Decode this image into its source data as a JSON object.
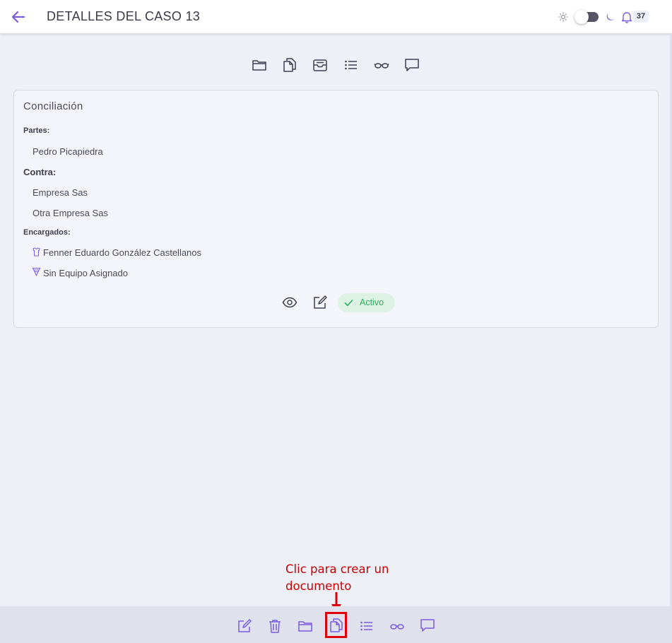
{
  "header": {
    "title": "DETALLES DEL CASO 13",
    "notifications_count": "37",
    "icons": [
      "arrow-left-icon",
      "sun-icon",
      "theme-toggle",
      "moon-icon",
      "bell-icon"
    ]
  },
  "top_toolbar": {
    "icons": [
      "folder-icon",
      "copy-document-icon",
      "inbox-icon",
      "list-icon",
      "glasses-icon",
      "chat-icon"
    ]
  },
  "card": {
    "title": "Conciliación",
    "parties_label": "Partes:",
    "parties": [
      "Pedro Picapiedra"
    ],
    "against_label": "Contra:",
    "against": [
      "Empresa Sas",
      "Otra Empresa Sas"
    ],
    "managers_label": "Encargados:",
    "managers": [
      {
        "name": "Fenner Eduardo González Castellanos",
        "icon": "user-tie-icon"
      },
      {
        "name": "Sin Equipo Asignado",
        "icon": "team-icon"
      }
    ],
    "actions": [
      "eye-icon",
      "edit-icon"
    ],
    "status": "Activo"
  },
  "bottom_bar": {
    "icons": [
      "edit-icon",
      "trash-icon",
      "folder-icon",
      "copy-document-icon",
      "list-icon",
      "glasses-icon",
      "chat-icon"
    ]
  },
  "annotation": {
    "text_line1": "Clic para crear un",
    "text_line2": "documento"
  },
  "colors": {
    "accent": "#7a5ce0",
    "background": "#eef0f8",
    "status_green": "#2fae5a",
    "annotation_red": "#e0000a"
  }
}
